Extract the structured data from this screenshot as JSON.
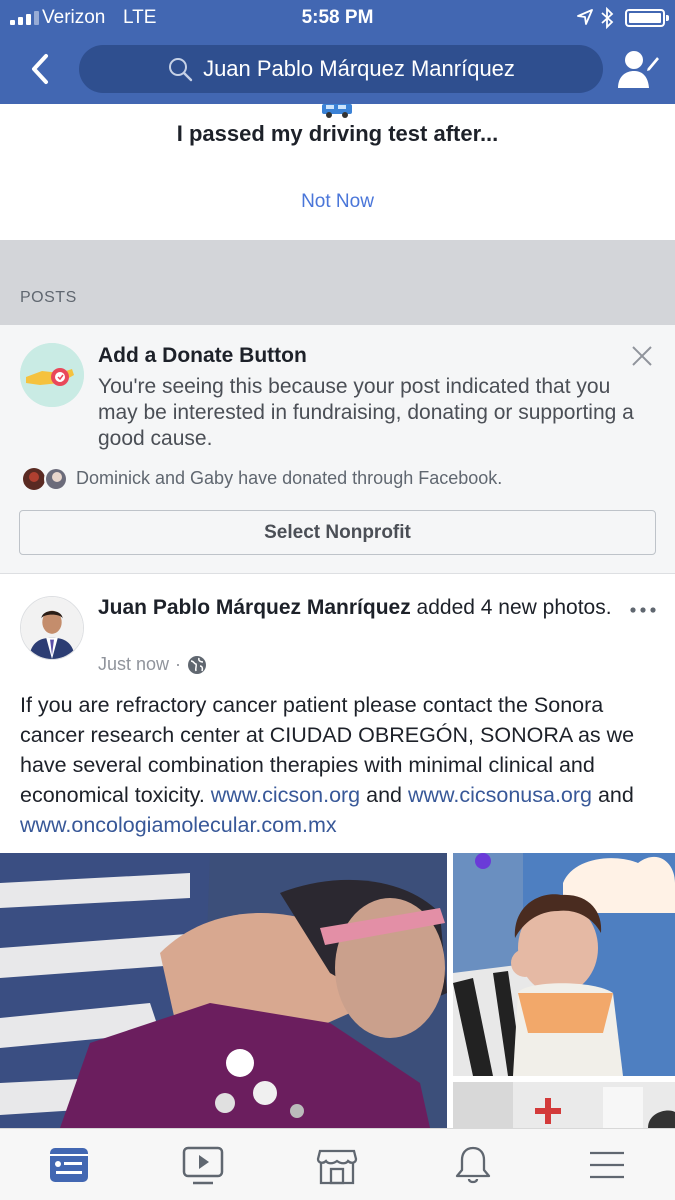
{
  "status_bar": {
    "carrier": "Verizon",
    "network": "LTE",
    "time": "5:58 PM"
  },
  "header": {
    "search_text": "Juan Pablo Márquez Manríquez"
  },
  "memory_prompt": {
    "text": "I passed my driving test after...",
    "dismiss_label": "Not Now"
  },
  "section_label": "POSTS",
  "donate_card": {
    "title": "Add a Donate Button",
    "description": "You're seeing this because your post indicated that you may be interested in fundraising, donating or supporting a good cause.",
    "donors_text": "Dominick and Gaby have donated through Facebook.",
    "button_label": "Select Nonprofit"
  },
  "post": {
    "author": "Juan Pablo Márquez Manríquez",
    "action": " added 4 new photos.",
    "time": "Just now",
    "separator": "·",
    "body_text": "If you are refractory cancer patient please contact the Sonora cancer research center at CIUDAD OBREGÓN, SONORA as we have several combination therapies with minimal clinical and economical toxicity. ",
    "link1": "www.cicson.org",
    "and1": " and ",
    "link2": "www.cicsonusa.org",
    "and2": " and ",
    "link3": "www.oncologiamolecular.com.mx"
  },
  "tabs": [
    "news-feed",
    "watch",
    "marketplace",
    "notifications",
    "menu"
  ],
  "colors": {
    "brand_blue": "#4267b2",
    "link_blue": "#385898",
    "active_tab": "#4267b2"
  }
}
